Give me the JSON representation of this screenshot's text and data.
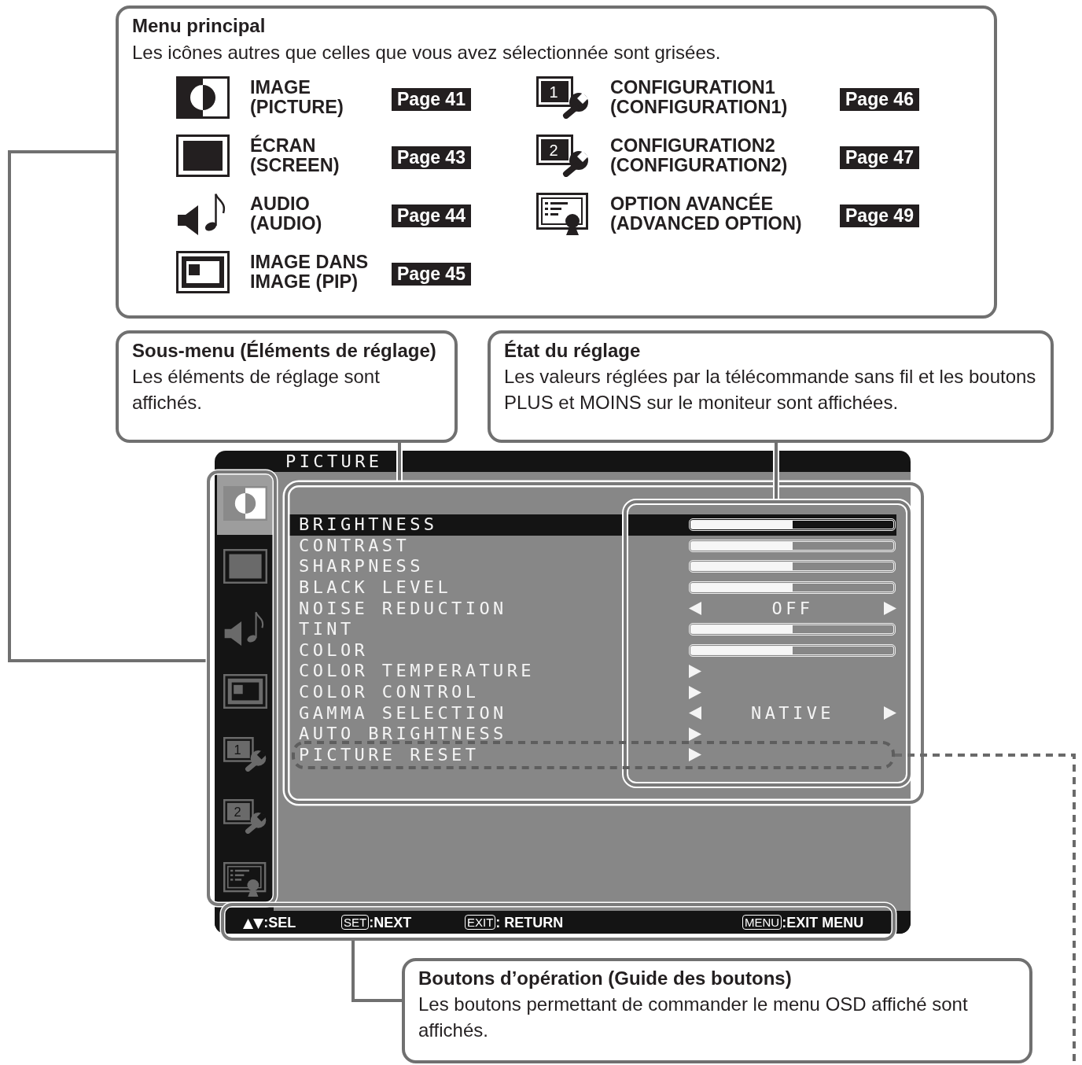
{
  "main_menu": {
    "title": "Menu principal",
    "description": "Les icônes autres que celles que vous avez sélectionnée sont grisées.",
    "items": [
      {
        "kind": "picture",
        "lines": [
          "IMAGE",
          "(PICTURE)"
        ],
        "page": "Page 41"
      },
      {
        "kind": "screen",
        "lines": [
          "ÉCRAN",
          "(SCREEN)"
        ],
        "page": "Page 43"
      },
      {
        "kind": "audio",
        "lines": [
          "AUDIO",
          "(AUDIO)"
        ],
        "page": "Page 44"
      },
      {
        "kind": "pip",
        "lines": [
          "IMAGE DANS",
          "IMAGE (PIP)"
        ],
        "page": "Page 45"
      },
      {
        "kind": "config",
        "icon_text": "1",
        "lines": [
          "CONFIGURATION1",
          "(CONFIGURATION1)"
        ],
        "page": "Page 46"
      },
      {
        "kind": "config",
        "icon_text": "2",
        "lines": [
          "CONFIGURATION2",
          "(CONFIGURATION2)"
        ],
        "page": "Page 47"
      },
      {
        "kind": "advanced",
        "lines": [
          "OPTION AVANCÉE",
          "(ADVANCED OPTION)"
        ],
        "page": "Page 49"
      }
    ]
  },
  "submenu_callout": {
    "title": "Sous-menu (Éléments de réglage)",
    "text": "Les éléments de réglage sont affichés."
  },
  "status_callout": {
    "title": "État du réglage",
    "text": "Les valeurs réglées par la télécommande sans fil et les boutons PLUS et MOINS sur le moniteur sont affichées."
  },
  "osd": {
    "title": "PICTURE",
    "sidebar": [
      {
        "kind": "picture",
        "selected": true
      },
      {
        "kind": "screen",
        "selected": false
      },
      {
        "kind": "audio",
        "selected": false
      },
      {
        "kind": "pip",
        "selected": false
      },
      {
        "kind": "config",
        "icon_text": "1",
        "selected": false
      },
      {
        "kind": "config",
        "icon_text": "2",
        "selected": false
      },
      {
        "kind": "advanced",
        "selected": false
      }
    ],
    "items": [
      {
        "label": "BRIGHTNESS",
        "kind": "slider",
        "level": 0.5,
        "selected": true
      },
      {
        "label": "CONTRAST",
        "kind": "slider",
        "level": 0.5,
        "selected": false
      },
      {
        "label": "SHARPNESS",
        "kind": "slider",
        "level": 0.5,
        "selected": false
      },
      {
        "label": "BLACK LEVEL",
        "kind": "slider",
        "level": 0.5,
        "selected": false
      },
      {
        "label": "NOISE REDUCTION",
        "kind": "choice",
        "value": "OFF",
        "selected": false
      },
      {
        "label": "TINT",
        "kind": "slider",
        "level": 0.5,
        "selected": false
      },
      {
        "label": "COLOR",
        "kind": "slider",
        "level": 0.5,
        "selected": false
      },
      {
        "label": "COLOR TEMPERATURE",
        "kind": "submenu",
        "selected": false
      },
      {
        "label": "COLOR CONTROL",
        "kind": "submenu",
        "selected": false
      },
      {
        "label": "GAMMA SELECTION",
        "kind": "choice",
        "value": "NATIVE",
        "selected": false
      },
      {
        "label": "AUTO BRIGHTNESS",
        "kind": "submenu",
        "selected": false
      },
      {
        "label": "PICTURE RESET",
        "kind": "submenu",
        "selected": false
      }
    ],
    "guide": [
      {
        "kind": "plain",
        "key": "▲▼",
        "action": ":SEL"
      },
      {
        "kind": "boxed",
        "key": "SET",
        "action": ":NEXT"
      },
      {
        "kind": "boxed",
        "key": "EXIT",
        "action": ": RETURN"
      },
      {
        "kind": "boxed",
        "key": "MENU",
        "action": ":EXIT MENU"
      }
    ]
  },
  "buttons_callout": {
    "title": "Boutons d’opération (Guide des boutons)",
    "text": "Les boutons permettant de commander le menu OSD affiché sont affichés."
  }
}
